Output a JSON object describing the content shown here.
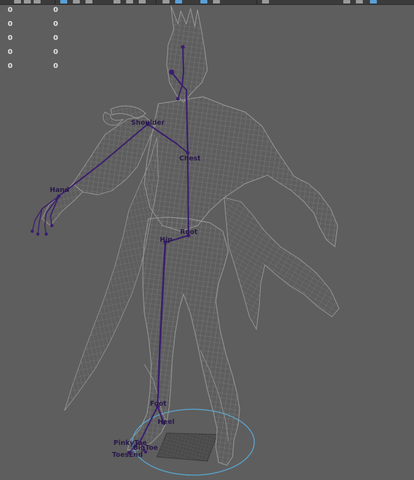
{
  "toolbar": {
    "icons": [
      "select-tool-icon",
      "lasso-tool-icon",
      "paint-tool-icon",
      "move-tool-icon",
      "rotate-tool-icon",
      "scale-tool-icon",
      "snap-grid-icon",
      "snap-curve-icon",
      "snap-point-icon",
      "snap-surface-icon",
      "history-icon",
      "render-icon",
      "ipr-render-icon",
      "render-settings-icon",
      "panel-layout-icon",
      "panel-layout-two-icon",
      "panel-layout-four-icon"
    ]
  },
  "hud": {
    "rows": [
      [
        "0",
        "0"
      ],
      [
        "0",
        "0"
      ],
      [
        "0",
        "0"
      ],
      [
        "0",
        "0"
      ],
      [
        "0",
        "0"
      ]
    ]
  },
  "joints": {
    "shoulder": "Shoulder",
    "chest": "Chest",
    "hand": "Hand",
    "root": "Root",
    "hip": "Hip",
    "foot": "Foot",
    "heel": "Heel",
    "pinky_toe": "PinkyToe",
    "big_toe": "BigToe",
    "toes_end": "ToesEnd"
  },
  "colors": {
    "viewport_bg": "#5e5e5e",
    "wireframe": "#8c8c8c",
    "skeleton": "#3a1d6e",
    "joint_label": "#2a1a4a",
    "manipulator": "#5aa9d6",
    "hud_text": "#e6e6e6"
  }
}
